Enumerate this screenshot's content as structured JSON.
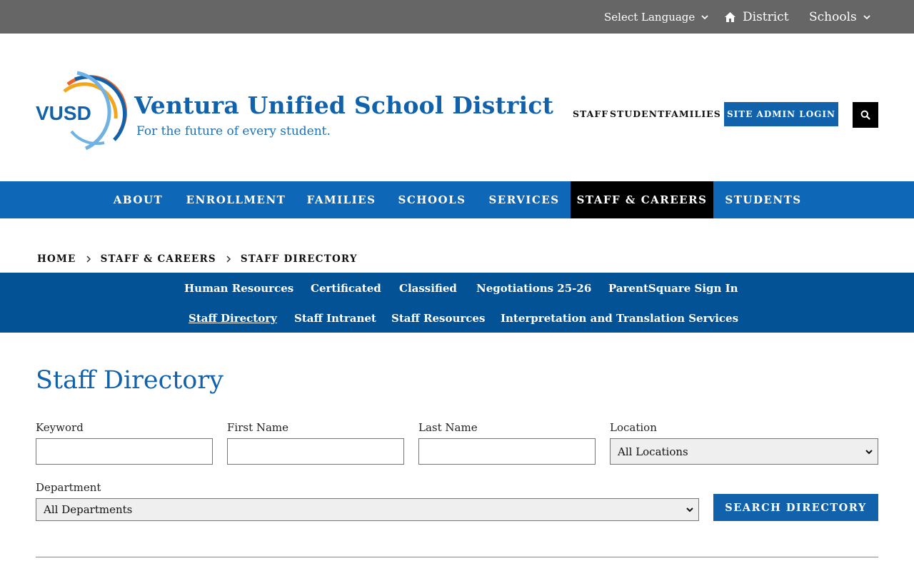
{
  "utility": {
    "language_label": "Select Language",
    "district_label": "District",
    "schools_label": "Schools"
  },
  "header": {
    "logo_text": "VUSD",
    "title": "Ventura Unified School District",
    "tagline": "For the future of every student.",
    "quick_links": [
      "STAFF",
      "STUDENT",
      "FAMILIES"
    ],
    "admin_login": "SITE ADMIN LOGIN"
  },
  "nav": {
    "items": [
      "ABOUT",
      "ENROLLMENT",
      "FAMILIES",
      "SCHOOLS",
      "SERVICES",
      "STAFF & CAREERS",
      "STUDENTS"
    ],
    "active": "STAFF & CAREERS"
  },
  "breadcrumb": [
    "HOME",
    "STAFF & CAREERS",
    "STAFF DIRECTORY"
  ],
  "subnav": {
    "row1": [
      "Human Resources",
      "Certificated",
      "Classified",
      "Negotiations 25-26",
      "ParentSquare Sign In"
    ],
    "row2": [
      "Staff Directory",
      "Staff Intranet",
      "Staff Resources",
      "Interpretation and Translation Services"
    ],
    "current": "Staff Directory"
  },
  "directory": {
    "title": "Staff Directory",
    "keyword_label": "Keyword",
    "keyword_value": "",
    "first_name_label": "First Name",
    "first_name_value": "",
    "last_name_label": "Last Name",
    "last_name_value": "",
    "location_label": "Location",
    "location_selected": "All Locations",
    "department_label": "Department",
    "department_selected": "All Departments",
    "search_button": "SEARCH DIRECTORY"
  },
  "colors": {
    "utility_bar": "#666666",
    "brand_blue": "#1162ab",
    "nav_blue": "#0f67b7",
    "subnav_blue": "#045296",
    "active_nav": "#000000"
  }
}
